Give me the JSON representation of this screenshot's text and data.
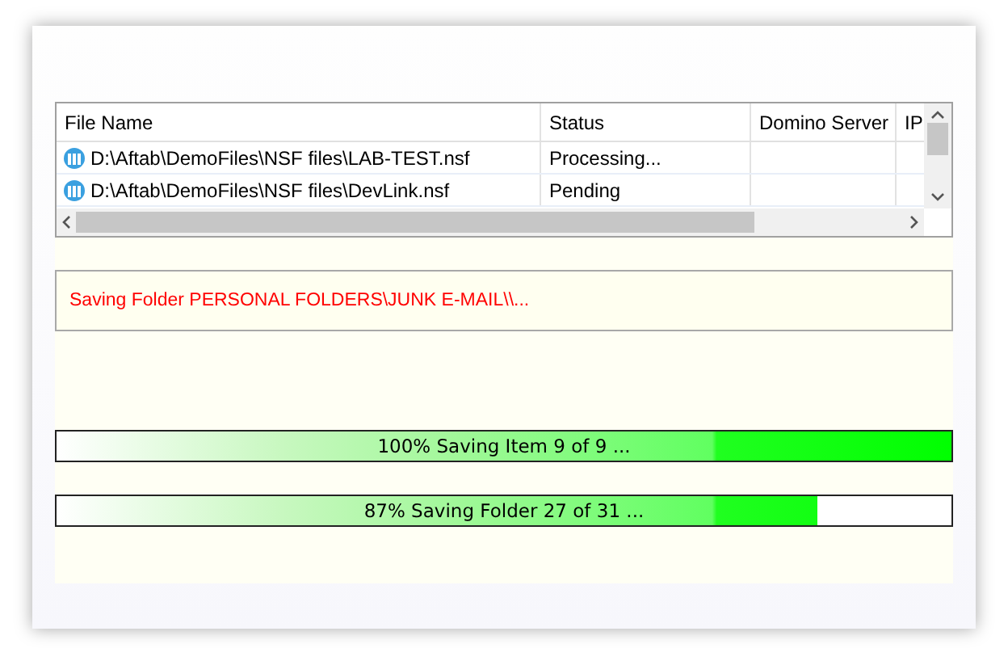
{
  "table": {
    "columns": [
      "File Name",
      "Status",
      "Domino Server",
      "IP"
    ],
    "rows": [
      {
        "file": "D:\\Aftab\\DemoFiles\\NSF files\\LAB-TEST.nsf",
        "status": "Processing..."
      },
      {
        "file": "D:\\Aftab\\DemoFiles\\NSF files\\DevLink.nsf",
        "status": "Pending"
      }
    ]
  },
  "message": "Saving Folder PERSONAL FOLDERS\\JUNK E-MAIL\\\\...",
  "progress": [
    {
      "label": "100% Saving Item 9 of 9 ...",
      "level": 1.0
    },
    {
      "label": "87% Saving Folder 27 of 31 ...",
      "level": 0.85
    }
  ]
}
